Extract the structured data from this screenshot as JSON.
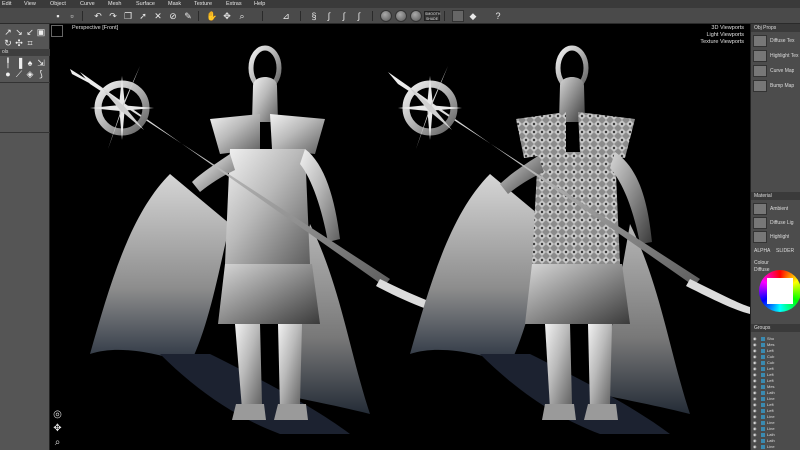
{
  "menu": [
    "Edit",
    "View",
    "Object",
    "Curve",
    "Mesh",
    "Surface",
    "Mask",
    "Texture",
    "Extras",
    "Help"
  ],
  "toolbar": {
    "smooth_label": "SMOOTH SHADE"
  },
  "left_panel": {
    "tools_header": "ols"
  },
  "viewport": {
    "label": "Perspective [Front]",
    "links": [
      "3D Viewports",
      "Light Viewports",
      "Texture Viewports"
    ]
  },
  "right_panel": {
    "obj_props_header": "Obj Props",
    "obj_props_items": [
      "Diffuse Tex",
      "Highlight Tex",
      "Curve Map",
      "Bump Map"
    ],
    "material_header": "Material",
    "material_items": [
      "Ambient",
      "Diffuse Lig",
      "Highlight"
    ],
    "alpha_label": "ALPHA",
    "slider_label": "SLIDER",
    "colour_header": "Colour",
    "diffuse_label": "Diffuse",
    "groups_header": "Groups",
    "groups": [
      "Sho",
      "Mes",
      "Left",
      "Cub",
      "Cub",
      "Left",
      "Left",
      "Left",
      "Mes",
      "Lath",
      "Line",
      "Left",
      "Left",
      "Line",
      "Line",
      "Line",
      "Lath",
      "Lath",
      "Line"
    ]
  }
}
